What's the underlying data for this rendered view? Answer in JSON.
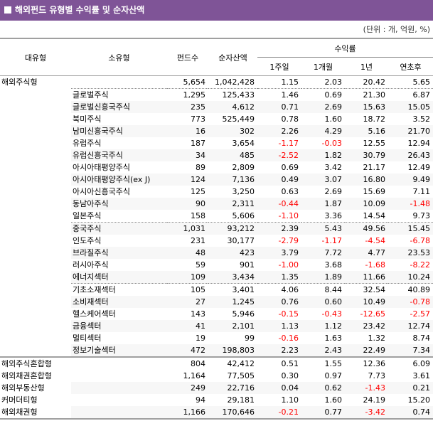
{
  "title": "해외펀드 유형별 수익률 및 순자산액",
  "unit": "(단위 : 개, 억원, %)",
  "colors": {
    "header": "#7f5497",
    "negative": "#ff0000"
  },
  "headers": {
    "major": "대유형",
    "minor": "소유형",
    "funds": "펀드수",
    "assets": "순자산액",
    "returns": "수익률",
    "w1": "1주일",
    "m1": "1개월",
    "y1": "1년",
    "ytd": "연초후"
  },
  "rows": [
    {
      "major": "해외주식형",
      "minor": "",
      "funds": "5,654",
      "assets": "1,042,428",
      "w1": "1.15",
      "m1": "2.03",
      "y1": "20.42",
      "ytd": "5.65"
    },
    {
      "major": "",
      "minor": "글로벌주식",
      "funds": "1,295",
      "assets": "125,433",
      "w1": "1.46",
      "m1": "0.69",
      "y1": "21.30",
      "ytd": "6.87"
    },
    {
      "major": "",
      "minor": "글로벌신흥국주식",
      "funds": "235",
      "assets": "4,612",
      "w1": "0.71",
      "m1": "2.69",
      "y1": "15.63",
      "ytd": "15.05"
    },
    {
      "major": "",
      "minor": "북미주식",
      "funds": "773",
      "assets": "525,449",
      "w1": "0.78",
      "m1": "1.60",
      "y1": "18.72",
      "ytd": "3.52"
    },
    {
      "major": "",
      "minor": "남미신흥국주식",
      "funds": "16",
      "assets": "302",
      "w1": "2.26",
      "m1": "4.29",
      "y1": "5.16",
      "ytd": "21.70"
    },
    {
      "major": "",
      "minor": "유럽주식",
      "funds": "187",
      "assets": "3,654",
      "w1": "-1.17",
      "m1": "-0.03",
      "y1": "12.55",
      "ytd": "12.94"
    },
    {
      "major": "",
      "minor": "유럽신흥국주식",
      "funds": "34",
      "assets": "485",
      "w1": "-2.52",
      "m1": "1.82",
      "y1": "30.79",
      "ytd": "26.43"
    },
    {
      "major": "",
      "minor": "아시아태평양주식",
      "funds": "89",
      "assets": "2,809",
      "w1": "0.69",
      "m1": "3.42",
      "y1": "21.17",
      "ytd": "12.49"
    },
    {
      "major": "",
      "minor": "아시아태평양주식(ex J)",
      "funds": "124",
      "assets": "7,136",
      "w1": "0.49",
      "m1": "3.07",
      "y1": "16.80",
      "ytd": "9.49"
    },
    {
      "major": "",
      "minor": "아시아신흥국주식",
      "funds": "125",
      "assets": "3,250",
      "w1": "0.63",
      "m1": "2.69",
      "y1": "15.69",
      "ytd": "7.11"
    },
    {
      "major": "",
      "minor": "동남아주식",
      "funds": "90",
      "assets": "2,311",
      "w1": "-0.44",
      "m1": "1.87",
      "y1": "10.09",
      "ytd": "-1.48"
    },
    {
      "major": "",
      "minor": "일본주식",
      "funds": "158",
      "assets": "5,606",
      "w1": "-1.10",
      "m1": "3.36",
      "y1": "14.54",
      "ytd": "9.73"
    },
    {
      "major": "",
      "minor": "중국주식",
      "funds": "1,031",
      "assets": "93,212",
      "w1": "2.39",
      "m1": "5.43",
      "y1": "49.56",
      "ytd": "15.45"
    },
    {
      "major": "",
      "minor": "인도주식",
      "funds": "231",
      "assets": "30,177",
      "w1": "-2.79",
      "m1": "-1.17",
      "y1": "-4.54",
      "ytd": "-6.78"
    },
    {
      "major": "",
      "minor": "브라질주식",
      "funds": "48",
      "assets": "423",
      "w1": "3.79",
      "m1": "7.72",
      "y1": "4.77",
      "ytd": "23.53"
    },
    {
      "major": "",
      "minor": "러시아주식",
      "funds": "59",
      "assets": "901",
      "w1": "-1.00",
      "m1": "3.68",
      "y1": "-1.68",
      "ytd": "-8.22"
    },
    {
      "major": "",
      "minor": "에너지섹터",
      "funds": "109",
      "assets": "3,434",
      "w1": "1.35",
      "m1": "1.89",
      "y1": "11.66",
      "ytd": "10.24"
    },
    {
      "major": "",
      "minor": "기초소재섹터",
      "funds": "105",
      "assets": "3,401",
      "w1": "4.06",
      "m1": "8.44",
      "y1": "32.54",
      "ytd": "40.89"
    },
    {
      "major": "",
      "minor": "소비재섹터",
      "funds": "27",
      "assets": "1,245",
      "w1": "0.76",
      "m1": "0.60",
      "y1": "10.49",
      "ytd": "-0.78"
    },
    {
      "major": "",
      "minor": "헬스케어섹터",
      "funds": "143",
      "assets": "5,946",
      "w1": "-0.15",
      "m1": "-0.43",
      "y1": "-12.65",
      "ytd": "-2.57"
    },
    {
      "major": "",
      "minor": "금융섹터",
      "funds": "41",
      "assets": "2,101",
      "w1": "1.13",
      "m1": "1.12",
      "y1": "23.42",
      "ytd": "12.74"
    },
    {
      "major": "",
      "minor": "멀티섹터",
      "funds": "19",
      "assets": "99",
      "w1": "-0.16",
      "m1": "1.63",
      "y1": "1.32",
      "ytd": "8.74"
    },
    {
      "major": "",
      "minor": "정보기술섹터",
      "funds": "472",
      "assets": "198,803",
      "w1": "2.23",
      "m1": "2.43",
      "y1": "22.49",
      "ytd": "7.34"
    },
    {
      "major": "해외주식혼합형",
      "minor": "",
      "funds": "804",
      "assets": "42,412",
      "w1": "0.51",
      "m1": "1.55",
      "y1": "12.36",
      "ytd": "6.09"
    },
    {
      "major": "해외채권혼합형",
      "minor": "",
      "funds": "1,164",
      "assets": "77,505",
      "w1": "0.30",
      "m1": "0.97",
      "y1": "7.73",
      "ytd": "3.61"
    },
    {
      "major": "해외부동산형",
      "minor": "",
      "funds": "249",
      "assets": "22,716",
      "w1": "0.04",
      "m1": "0.62",
      "y1": "-1.43",
      "ytd": "0.21"
    },
    {
      "major": "커머더티형",
      "minor": "",
      "funds": "94",
      "assets": "29,181",
      "w1": "1.10",
      "m1": "1.60",
      "y1": "24.19",
      "ytd": "15.20"
    },
    {
      "major": "해외채권형",
      "minor": "",
      "funds": "1,166",
      "assets": "170,646",
      "w1": "-0.21",
      "m1": "0.77",
      "y1": "-3.42",
      "ytd": "0.74"
    }
  ]
}
